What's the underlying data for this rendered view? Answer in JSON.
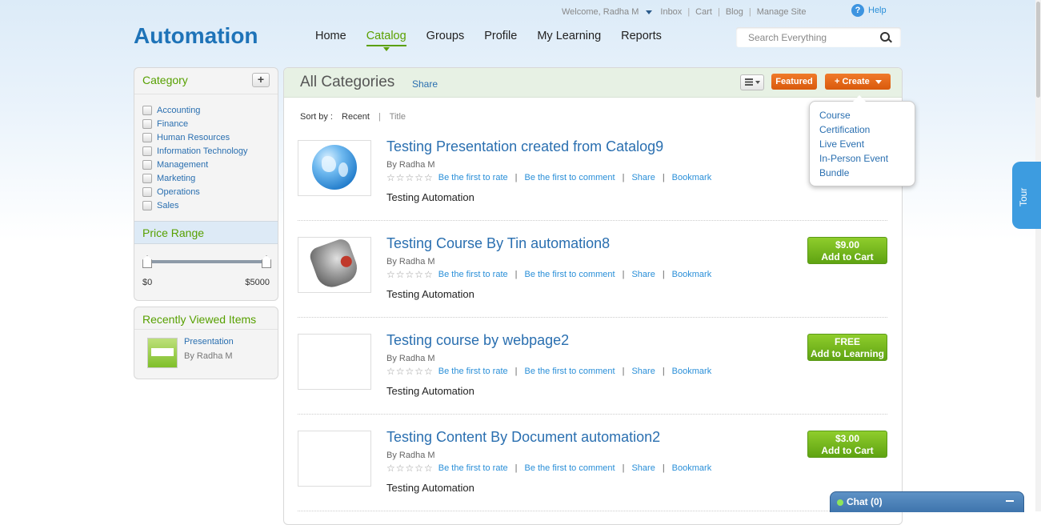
{
  "brand": {
    "logo": "Automation"
  },
  "topbar": {
    "welcome": "Welcome, Radha M",
    "links": [
      "Inbox",
      "Cart",
      "Blog",
      "Manage Site"
    ],
    "help": "Help"
  },
  "nav": {
    "items": [
      "Home",
      "Catalog",
      "Groups",
      "Profile",
      "My Learning",
      "Reports"
    ],
    "active": "Catalog"
  },
  "search": {
    "placeholder": "Search Everything"
  },
  "sidebar": {
    "category": {
      "title": "Category",
      "add_label": "+",
      "items": [
        "Accounting",
        "Finance",
        "Human Resources",
        "Information Technology",
        "Management",
        "Marketing",
        "Operations",
        "Sales"
      ]
    },
    "price": {
      "title": "Price Range",
      "min": "$0",
      "max": "$5000"
    },
    "recent": {
      "title": "Recently Viewed Items",
      "items": [
        {
          "title": "Presentation",
          "by": "By Radha M"
        }
      ]
    }
  },
  "main": {
    "title": "All Categories",
    "share": "Share",
    "featured": "Featured",
    "create": "+ Create",
    "sort": {
      "label": "Sort by :",
      "options": [
        "Recent",
        "Title"
      ],
      "selected": "Recent"
    },
    "create_menu": [
      "Course",
      "Certification",
      "Live Event",
      "In-Person Event",
      "Bundle"
    ],
    "items": [
      {
        "title": "Testing Presentation created from Catalog9",
        "by": "By Radha M",
        "rate": "Be the first to rate",
        "comment": "Be the first to comment",
        "share": "Share",
        "bookmark": "Bookmark",
        "desc": "Testing Automation",
        "price": "",
        "action": ""
      },
      {
        "title": "Testing Course By Tin automation8",
        "by": "By Radha M",
        "rate": "Be the first to rate",
        "comment": "Be the first to comment",
        "share": "Share",
        "bookmark": "Bookmark",
        "desc": "Testing Automation",
        "price": "$9.00",
        "action": "Add to Cart"
      },
      {
        "title": "Testing course by webpage2",
        "by": "By Radha M",
        "rate": "Be the first to rate",
        "comment": "Be the first to comment",
        "share": "Share",
        "bookmark": "Bookmark",
        "desc": "Testing Automation",
        "price": "FREE",
        "action": "Add to Learning"
      },
      {
        "title": "Testing Content By Document automation2",
        "by": "By Radha M",
        "rate": "Be the first to rate",
        "comment": "Be the first to comment",
        "share": "Share",
        "bookmark": "Bookmark",
        "desc": "Testing Automation",
        "price": "$3.00",
        "action": "Add to Cart"
      }
    ]
  },
  "tour": {
    "label": "Tour"
  },
  "chat": {
    "label": "Chat  (0)"
  },
  "colors": {
    "brand_blue": "#1e73b8",
    "accent_green": "#5aa000",
    "create_orange": "#e0621a",
    "cart_green": "#7ab81f"
  }
}
